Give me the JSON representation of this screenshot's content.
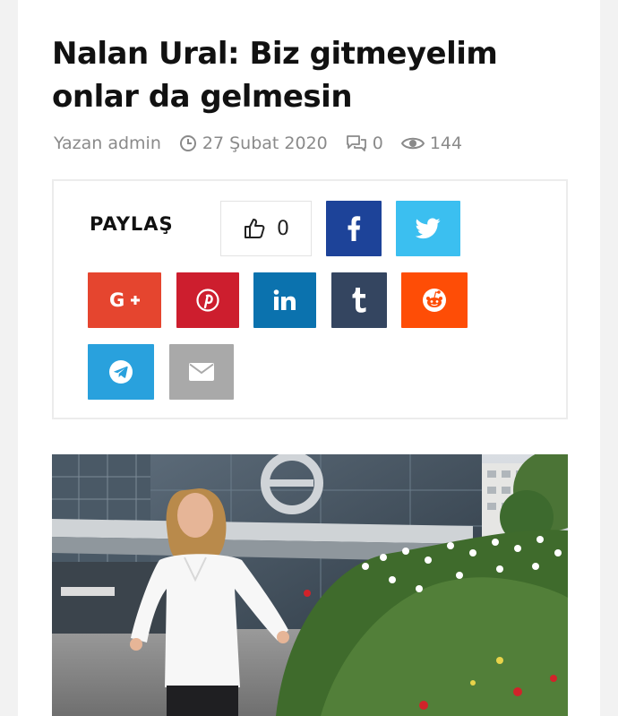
{
  "article": {
    "title": "Nalan Ural: Biz gitmeyelim onlar da gelmesin",
    "author": "Yazan admin",
    "date": "27 Şubat 2020",
    "comments": "0",
    "views": "144"
  },
  "share": {
    "label": "PAYLAŞ",
    "like_count": "0",
    "buttons": [
      {
        "name": "facebook",
        "icon": "facebook-icon",
        "color": "#1d4399"
      },
      {
        "name": "twitter",
        "icon": "twitter-icon",
        "color": "#3bbff0"
      },
      {
        "name": "google-plus",
        "icon": "google-plus-icon",
        "color": "#e5452f"
      },
      {
        "name": "pinterest",
        "icon": "pinterest-icon",
        "color": "#cd1e2e"
      },
      {
        "name": "linkedin",
        "icon": "linkedin-icon",
        "color": "#0b72ae"
      },
      {
        "name": "tumblr",
        "icon": "tumblr-icon",
        "color": "#344560"
      },
      {
        "name": "reddit",
        "icon": "reddit-icon",
        "color": "#fe4d06"
      },
      {
        "name": "telegram",
        "icon": "telegram-icon",
        "color": "#29a1dd"
      },
      {
        "name": "email",
        "icon": "envelope-icon",
        "color": "#a9a9a9"
      }
    ]
  },
  "featured_image": {
    "logo_letter": "e"
  }
}
